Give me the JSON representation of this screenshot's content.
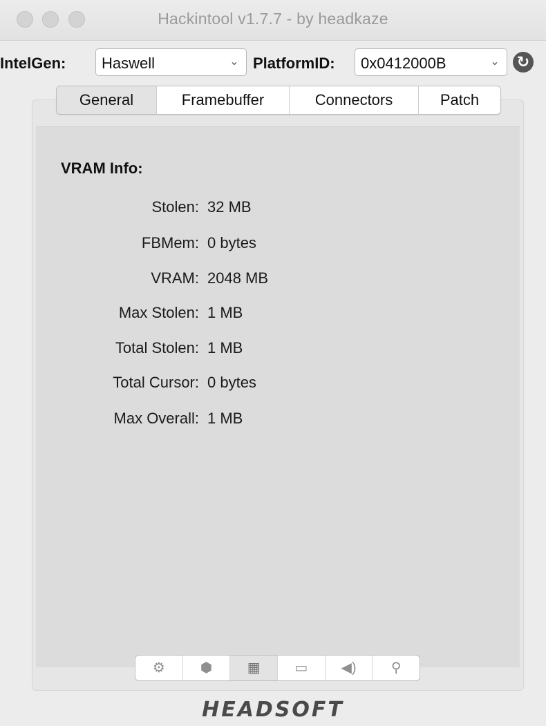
{
  "window": {
    "title": "Hackintool v1.7.7 - by headkaze"
  },
  "toolbar": {
    "intelgen_label": "IntelGen:",
    "intelgen_value": "Haswell",
    "platform_label": "PlatformID:",
    "platform_value": "0x0412000B",
    "refresh_icon": "refresh-icon"
  },
  "tabs": [
    {
      "label": "General"
    },
    {
      "label": "Framebuffer"
    },
    {
      "label": "Connectors"
    },
    {
      "label": "Patch"
    }
  ],
  "active_tab": "General",
  "vram": {
    "title": "VRAM Info:",
    "rows": [
      {
        "key": "Stolen:",
        "value": "32 MB"
      },
      {
        "key": "FBMem:",
        "value": "0 bytes"
      },
      {
        "key": "VRAM:",
        "value": "2048 MB"
      },
      {
        "key": "Max Stolen:",
        "value": "1 MB"
      },
      {
        "key": "Total Stolen:",
        "value": "1 MB"
      },
      {
        "key": "Total Cursor:",
        "value": "0 bytes"
      },
      {
        "key": "Max Overall:",
        "value": "1 MB"
      }
    ]
  },
  "bottom_bar": {
    "icons": [
      "gear-icon",
      "shield-icon",
      "chip-icon",
      "display-icon",
      "speaker-icon",
      "usb-icon"
    ],
    "active_index": 2
  },
  "logo": {
    "text": "HEADSOFT"
  }
}
